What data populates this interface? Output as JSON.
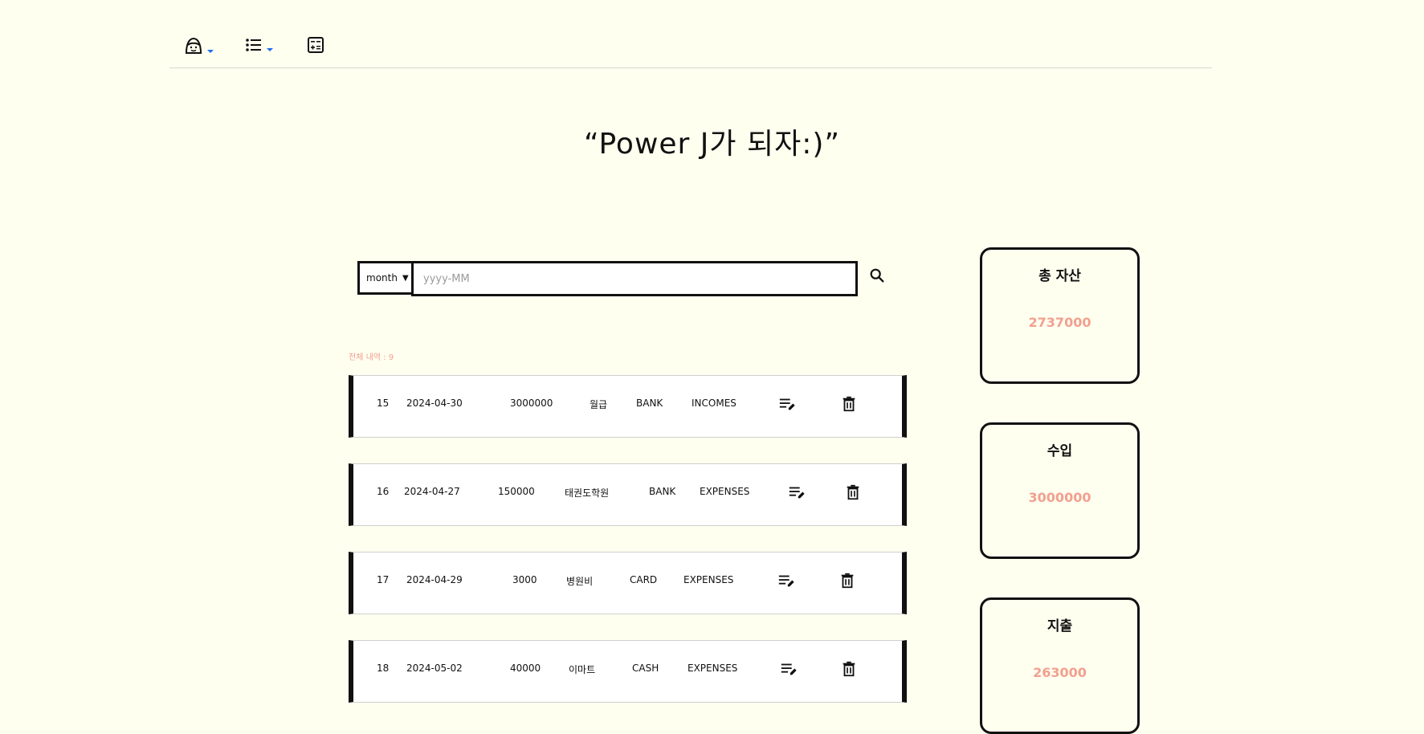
{
  "nav": {
    "profile_icon": "profile-face-icon",
    "list_icon": "list-icon",
    "calculator_icon": "calculator-icon"
  },
  "headline": "“Power J가 되자:)”",
  "search": {
    "period_select": "month",
    "placeholder": "yyyy-MM"
  },
  "total_count": "전체 내역 : 9",
  "records": [
    {
      "id": "15",
      "date": "2024-04-30",
      "amount": "3000000",
      "memo": "월급",
      "method": "BANK",
      "type": "INCOMES"
    },
    {
      "id": "16",
      "date": "2024-04-27",
      "amount": "150000",
      "memo": "태권도학원",
      "method": "BANK",
      "type": "EXPENSES"
    },
    {
      "id": "17",
      "date": "2024-04-29",
      "amount": "3000",
      "memo": "병원비",
      "method": "CARD",
      "type": "EXPENSES"
    },
    {
      "id": "18",
      "date": "2024-05-02",
      "amount": "40000",
      "memo": "이마트",
      "method": "CASH",
      "type": "EXPENSES"
    }
  ],
  "summary": {
    "total_assets": {
      "title": "총 자산",
      "value": "2737000"
    },
    "income": {
      "title": "수입",
      "value": "3000000"
    },
    "expense": {
      "title": "지출",
      "value": "263000"
    }
  },
  "colors": {
    "background": "#fffff0",
    "accent": "#f2a08f",
    "caret": "#1e6cf0",
    "border": "#111111"
  }
}
